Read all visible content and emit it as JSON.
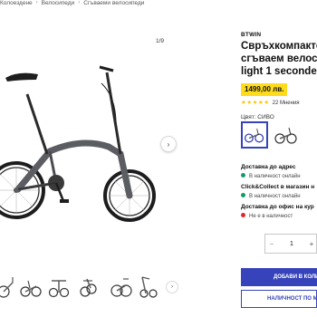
{
  "breadcrumb": [
    "Колоездене",
    "Велосипеди",
    "Сгъваеми велосипеди"
  ],
  "gallery": {
    "counter": "1/9",
    "next_icon": "chevron-right-icon",
    "thumbs_next_icon": "chevron-right-icon"
  },
  "product": {
    "brand": "BTWIN",
    "title_lines": [
      "Свръхкомпакте",
      "сгъваем велосі",
      "light 1 seconde,"
    ],
    "price": "1499,00 лв.",
    "rating_stars": "★★★★★",
    "reviews": "22 Мнения",
    "color_label": "Цвят: СИВО"
  },
  "delivery": {
    "address_title": "Доставка до адрес",
    "address_status": "В наличност онлайн",
    "click_title": "Click&Collect в магазин н",
    "click_status": "В наличност онлайн",
    "office_title": "Доставка до офис на кур",
    "office_status": "Не е в наличност"
  },
  "quantity": {
    "value": "1",
    "minus": "−",
    "plus": "+"
  },
  "buttons": {
    "add_to_cart": "ДОБАВИ В КОЛИ",
    "stock": "НАЛИЧНОСТ ПО М"
  },
  "colors": {
    "accent": "#3643ba",
    "price_bg": "#fedb1d",
    "in_stock": "#149b65",
    "out_of_stock": "#e3262f",
    "frame": "#5b5d62"
  }
}
